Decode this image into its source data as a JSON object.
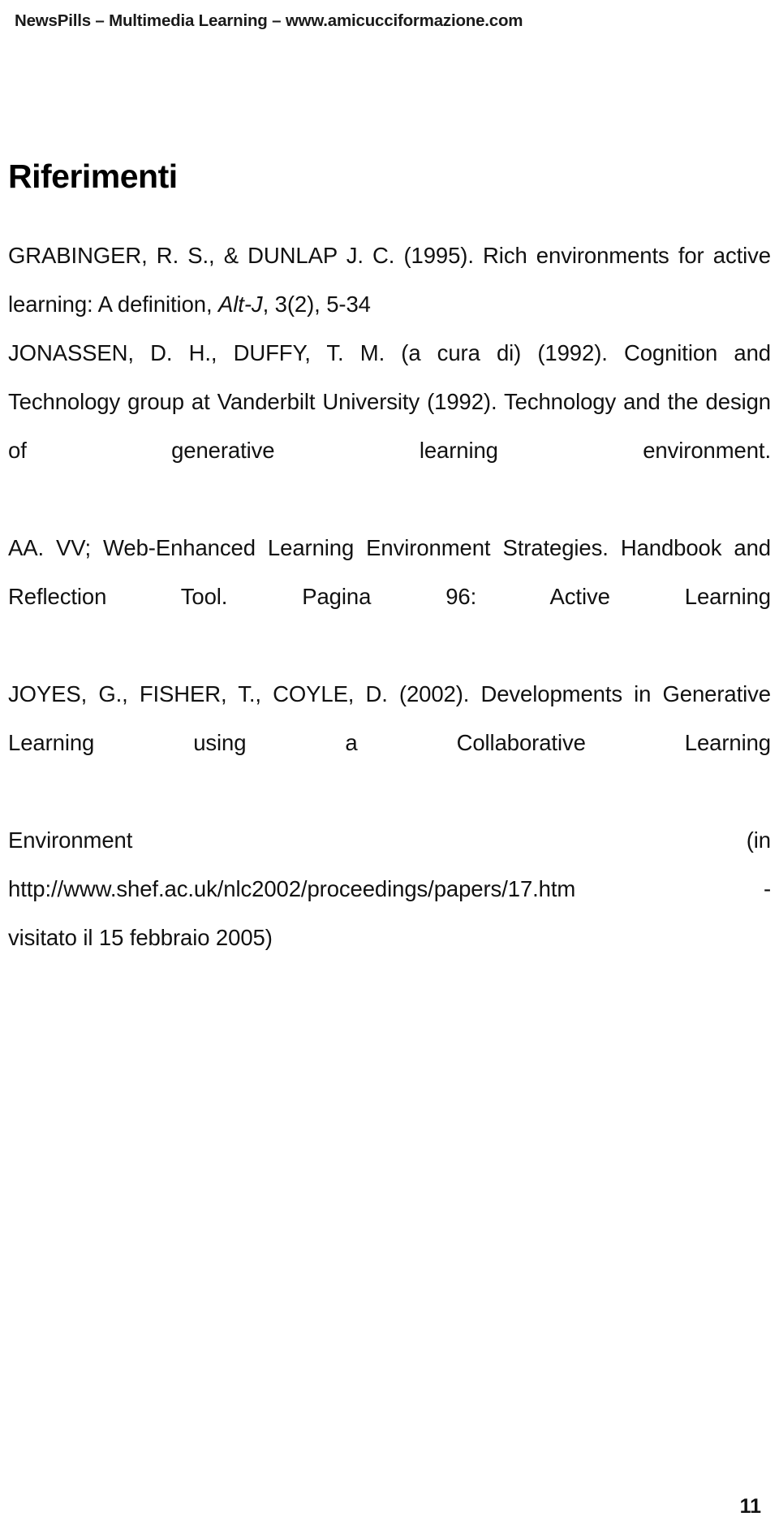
{
  "document": {
    "running_header": "NewsPills – Multimedia Learning – www.amicucciformazione.com",
    "section_title": "Riferimenti",
    "page_number": "11",
    "references": {
      "grabinger": {
        "part1": "GRABINGER, R. S., & DUNLAP  J. C. (1995). Rich environments for active learning: A definition, ",
        "italic": "Alt-J",
        "part2": ", 3(2), 5-34"
      },
      "jonassen": "JONASSEN, D. H., DUFFY, T. M. (a cura di) (1992). Cognition and Technology group at Vanderbilt University (1992). Technology and the design of generative learning environment.",
      "aavv": "AA. VV; Web-Enhanced Learning Environment Strategies. Handbook and Reflection Tool. Pagina 96: Active Learning",
      "joyes": {
        "text": "JOYES, G., FISHER, T., COYLE, D. (2002). Developments in Generative Learning using a Collaborative Learning",
        "env_left": "Environment",
        "env_right": "(in",
        "url_left": "http://www.shef.ac.uk/nlc2002/proceedings/papers/17.htm",
        "url_right": "-",
        "visited": "visitato il 15 febbraio 2005)"
      }
    }
  }
}
